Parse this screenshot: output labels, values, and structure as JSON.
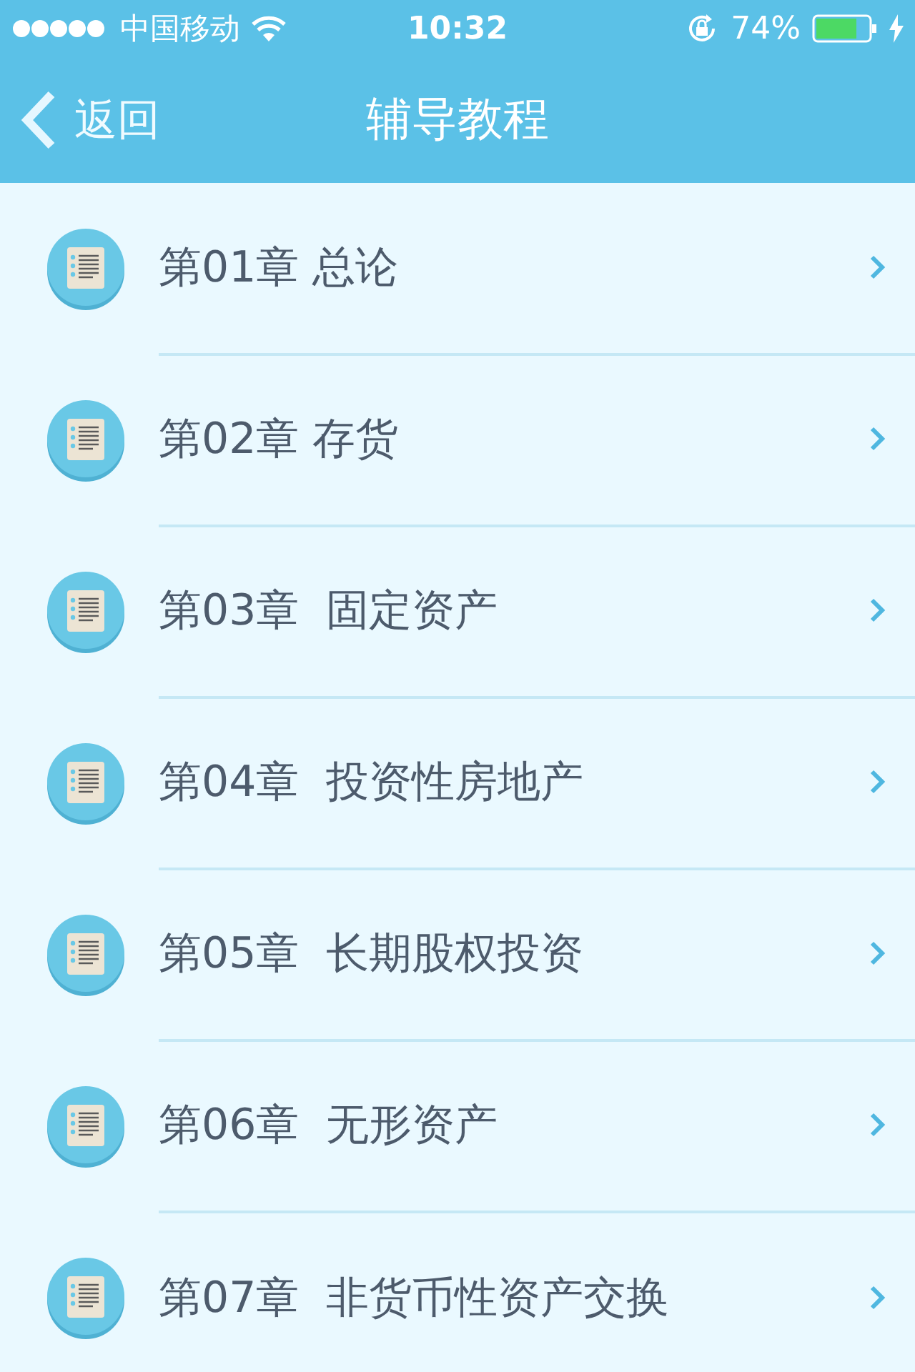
{
  "status_bar": {
    "carrier": "中国移动",
    "time": "10:32",
    "battery_percent": "74%"
  },
  "nav_bar": {
    "back_label": "返回",
    "title": "辅导教程"
  },
  "chapters": [
    {
      "label": "第01章 总论"
    },
    {
      "label": "第02章 存货"
    },
    {
      "label": "第03章  固定资产"
    },
    {
      "label": "第04章  投资性房地产"
    },
    {
      "label": "第05章  长期股权投资"
    },
    {
      "label": "第06章  无形资产"
    },
    {
      "label": "第07章  非货币性资产交换"
    }
  ]
}
